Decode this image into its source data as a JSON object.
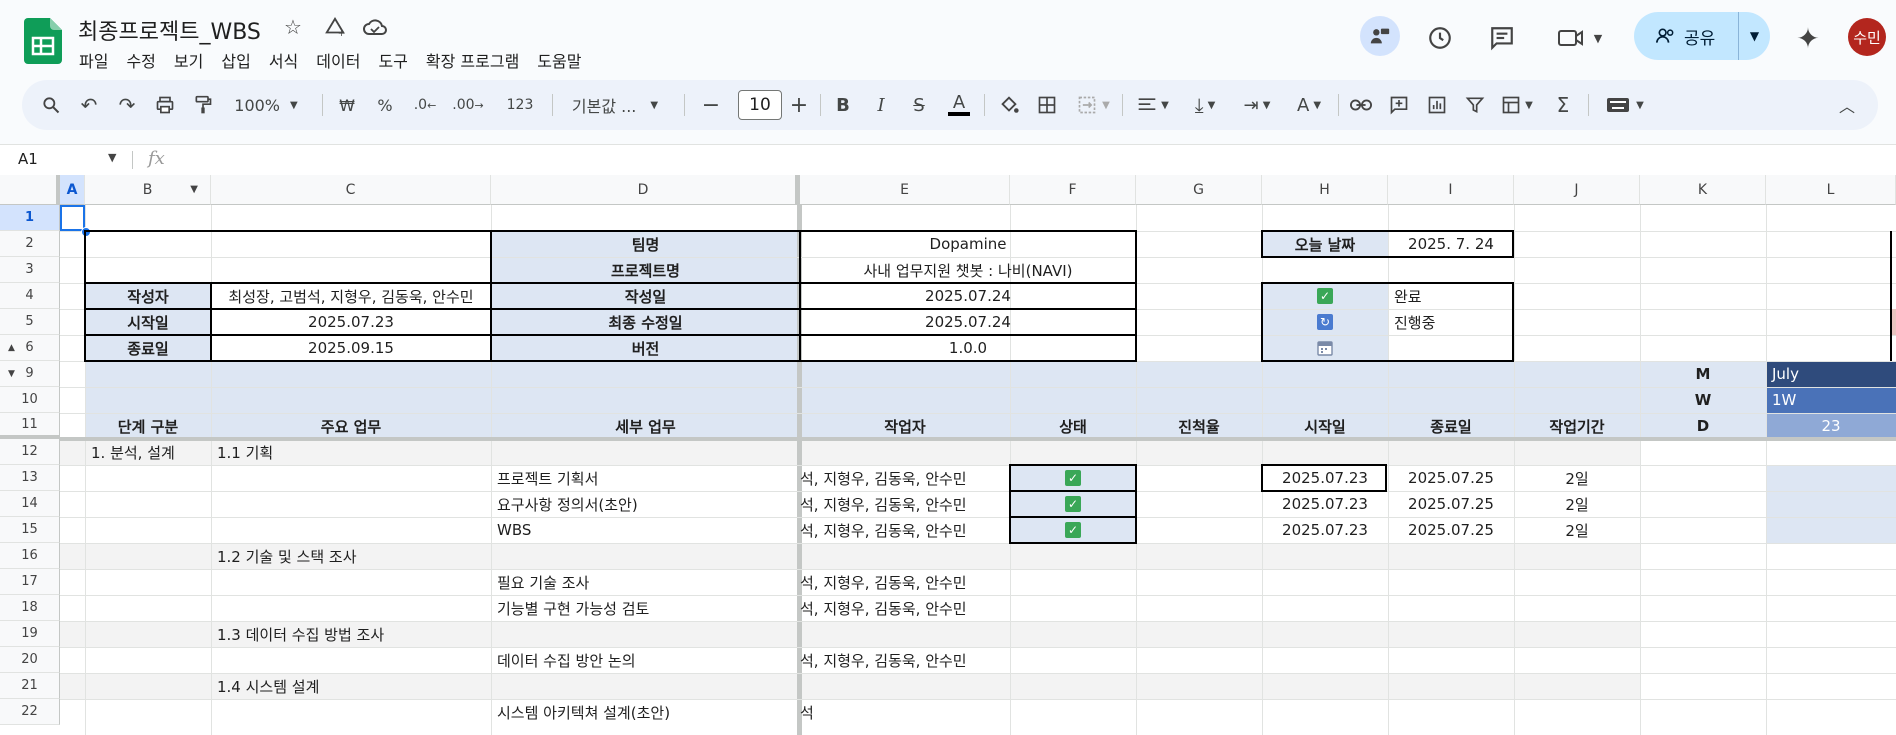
{
  "app": {
    "title": "최종프로젝트_WBS",
    "menu": [
      "파일",
      "수정",
      "보기",
      "삽입",
      "서식",
      "데이터",
      "도구",
      "확장 프로그램",
      "도움말"
    ],
    "share_label": "공유",
    "avatar_initials": "수민",
    "accent_color": "#c2e7ff",
    "brand_color": "#0f9d58"
  },
  "toolbar": {
    "zoom": "100%",
    "currency": "₩",
    "percent": "%",
    "dec_decrease": ".0",
    "dec_increase": ".00",
    "number_format": "123",
    "font": "기본값 ...",
    "font_size": "10"
  },
  "formula_bar": {
    "name_box": "A1",
    "fx_label": "fx",
    "value": ""
  },
  "columns": [
    "A",
    "B",
    "C",
    "D",
    "E",
    "F",
    "G",
    "H",
    "I",
    "J",
    "K",
    "L"
  ],
  "rows": [
    "1",
    "2",
    "3",
    "4",
    "5",
    "6",
    "9",
    "10",
    "11",
    "12",
    "13",
    "14",
    "15",
    "16",
    "17",
    "18",
    "19",
    "20",
    "21",
    "22"
  ],
  "info": {
    "team_label": "팀명",
    "team_value": "Dopamine",
    "project_label": "프로젝트명",
    "project_value": "사내 업무지원 챗봇 : 나비(NAVI)",
    "author_label": "작성자",
    "author_value": "최성장, 고범석, 지형우, 김동욱, 안수민",
    "created_label": "작성일",
    "created_value": "2025.07.24",
    "start_label": "시작일",
    "start_value": "2025.07.23",
    "modified_label": "최종 수정일",
    "modified_value": "2025.07.24",
    "end_label": "종료일",
    "end_value": "2025.09.15",
    "version_label": "버전",
    "version_value": "1.0.0",
    "today_label": "오늘 날짜",
    "today_value": "2025. 7. 24",
    "legend_done": "완료",
    "legend_progress": "진행중"
  },
  "header": {
    "stage": "단계 구분",
    "main_task": "주요 업무",
    "detail_task": "세부 업무",
    "worker": "작업자",
    "status": "상태",
    "progress": "진척율",
    "start": "시작일",
    "end": "종료일",
    "duration": "작업기간",
    "m_label": "M",
    "w_label": "W",
    "d_label": "D",
    "month": "July",
    "week": "1W",
    "day": "23"
  },
  "tasks": {
    "stage1": "1. 분석, 설계",
    "g1": "1.1 기획",
    "g2": "1.2 기술 및 스택 조사",
    "g3": "1.3 데이터 수집 방법 조사",
    "g4": "1.4 시스템 설계",
    "t1": "프로젝트 기획서",
    "t2": "요구사항 정의서(초안)",
    "t3": "WBS",
    "t4": "필요 기술 조사",
    "t5": "기능별 구현 가능성 검토",
    "t6": "데이터 수집 방안 논의",
    "t7": "시스템 아키텍쳐 설계(초안)",
    "worker": "석, 지형우, 김동욱, 안수민",
    "worker_short": "석",
    "start": "2025.07.23",
    "end": "2025.07.25",
    "duration": "2일"
  }
}
